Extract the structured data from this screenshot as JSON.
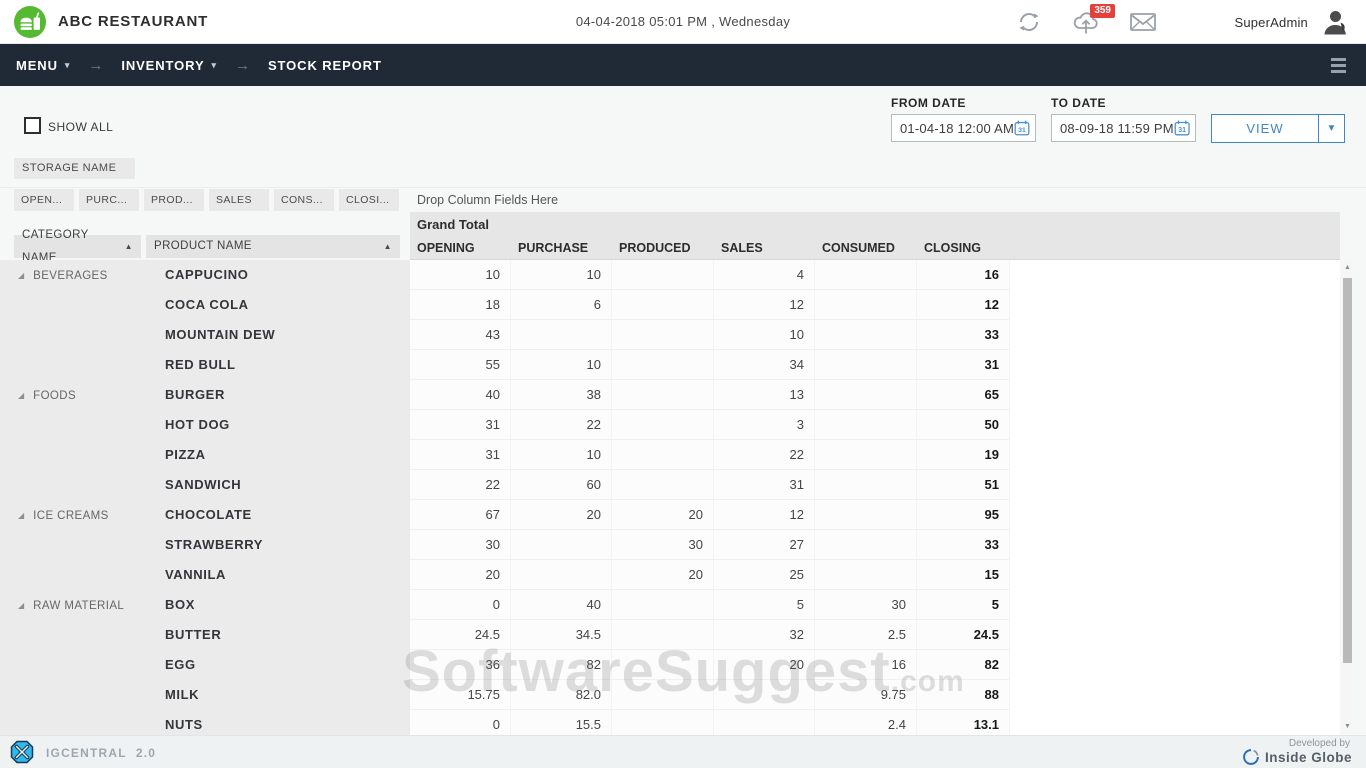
{
  "header": {
    "app_name": "ABC RESTAURANT",
    "datetime": "04-04-2018  05:01 PM , Wednesday",
    "notification_badge": "359",
    "username": "SuperAdmin"
  },
  "navbar": {
    "menu_label": "MENU",
    "inventory_label": "INVENTORY",
    "page_label": "STOCK REPORT"
  },
  "filters": {
    "show_all_label": "SHOW ALL",
    "from_date_label": "FROM DATE",
    "from_date_value": "01-04-18 12:00 AM",
    "to_date_label": "TO DATE",
    "to_date_value": "08-09-18 11:59 PM",
    "view_button_label": "VIEW",
    "calendar_day": "31"
  },
  "pivot": {
    "storage_field_label": "STORAGE NAME",
    "column_fields": [
      "OPEN...",
      "PURC...",
      "PROD...",
      "SALES",
      "CONS...",
      "CLOSI..."
    ],
    "drop_hint": "Drop Column Fields Here",
    "grand_total_label": "Grand Total",
    "category_field_label": "CATEGORY NAME",
    "product_field_label": "PRODUCT NAME",
    "columns": [
      "OPENING",
      "PURCHASE",
      "PRODUCED",
      "SALES",
      "CONSUMED",
      "CLOSING"
    ],
    "rows": [
      {
        "category": "BEVERAGES",
        "product": "CAPPUCINO",
        "values": [
          "10",
          "10",
          "",
          "4",
          "",
          "16"
        ]
      },
      {
        "category": "",
        "product": "COCA COLA",
        "values": [
          "18",
          "6",
          "",
          "12",
          "",
          "12"
        ]
      },
      {
        "category": "",
        "product": "MOUNTAIN DEW",
        "values": [
          "43",
          "",
          "",
          "10",
          "",
          "33"
        ]
      },
      {
        "category": "",
        "product": "RED BULL",
        "values": [
          "55",
          "10",
          "",
          "34",
          "",
          "31"
        ]
      },
      {
        "category": "FOODS",
        "product": "BURGER",
        "values": [
          "40",
          "38",
          "",
          "13",
          "",
          "65"
        ]
      },
      {
        "category": "",
        "product": "HOT DOG",
        "values": [
          "31",
          "22",
          "",
          "3",
          "",
          "50"
        ]
      },
      {
        "category": "",
        "product": "PIZZA",
        "values": [
          "31",
          "10",
          "",
          "22",
          "",
          "19"
        ]
      },
      {
        "category": "",
        "product": "SANDWICH",
        "values": [
          "22",
          "60",
          "",
          "31",
          "",
          "51"
        ]
      },
      {
        "category": "ICE CREAMS",
        "product": "CHOCOLATE",
        "values": [
          "67",
          "20",
          "20",
          "12",
          "",
          "95"
        ]
      },
      {
        "category": "",
        "product": "STRAWBERRY",
        "values": [
          "30",
          "",
          "30",
          "27",
          "",
          "33"
        ]
      },
      {
        "category": "",
        "product": "VANNILA",
        "values": [
          "20",
          "",
          "20",
          "25",
          "",
          "15"
        ]
      },
      {
        "category": "RAW MATERIAL",
        "product": "BOX",
        "values": [
          "0",
          "40",
          "",
          "5",
          "30",
          "5"
        ]
      },
      {
        "category": "",
        "product": "BUTTER",
        "values": [
          "24.5",
          "34.5",
          "",
          "32",
          "2.5",
          "24.5"
        ]
      },
      {
        "category": "",
        "product": "EGG",
        "values": [
          "36",
          "82",
          "",
          "20",
          "16",
          "82"
        ]
      },
      {
        "category": "",
        "product": "MILK",
        "values": [
          "15.75",
          "82.0",
          "",
          "",
          "9.75",
          "88"
        ]
      },
      {
        "category": "",
        "product": "NUTS",
        "values": [
          "0",
          "15.5",
          "",
          "",
          "2.4",
          "13.1"
        ]
      }
    ]
  },
  "footer": {
    "product_name": "IGCENTRAL",
    "version": "2.0",
    "developed_by": "Developed by",
    "developer_name": "Inside Globe"
  },
  "watermark": {
    "text": "SoftwareSuggest",
    "suffix": ".com"
  },
  "colors": {
    "navbar": "#1f2a36",
    "accent_blue": "#3f87c5",
    "logo_green": "#56b932",
    "badge_red": "#e5403b"
  }
}
